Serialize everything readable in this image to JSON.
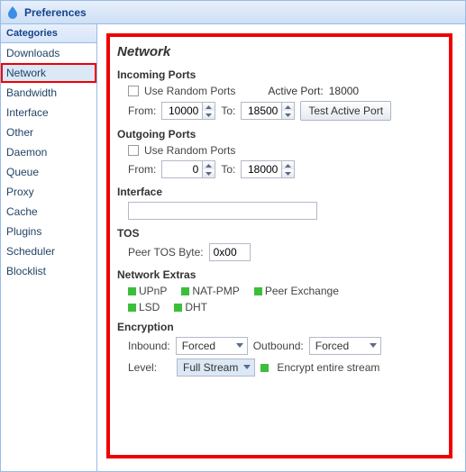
{
  "window": {
    "title": "Preferences"
  },
  "sidebar": {
    "header": "Categories",
    "items": [
      {
        "label": "Downloads"
      },
      {
        "label": "Network",
        "selected": true
      },
      {
        "label": "Bandwidth"
      },
      {
        "label": "Interface"
      },
      {
        "label": "Other"
      },
      {
        "label": "Daemon"
      },
      {
        "label": "Queue"
      },
      {
        "label": "Proxy"
      },
      {
        "label": "Cache"
      },
      {
        "label": "Plugins"
      },
      {
        "label": "Scheduler"
      },
      {
        "label": "Blocklist"
      }
    ]
  },
  "page": {
    "title": "Network",
    "incoming": {
      "title": "Incoming Ports",
      "random_label": "Use Random Ports",
      "active_port_label": "Active Port:",
      "active_port_value": "18000",
      "from_label": "From:",
      "from_value": "10000",
      "to_label": "To:",
      "to_value": "18500",
      "test_button": "Test Active Port"
    },
    "outgoing": {
      "title": "Outgoing Ports",
      "random_label": "Use Random Ports",
      "from_label": "From:",
      "from_value": "0",
      "to_label": "To:",
      "to_value": "18000"
    },
    "interface": {
      "title": "Interface",
      "value": ""
    },
    "tos": {
      "title": "TOS",
      "label": "Peer TOS Byte:",
      "value": "0x00"
    },
    "extras": {
      "title": "Network Extras",
      "items": [
        "UPnP",
        "NAT-PMP",
        "Peer Exchange",
        "LSD",
        "DHT"
      ]
    },
    "encryption": {
      "title": "Encryption",
      "inbound_label": "Inbound:",
      "inbound_value": "Forced",
      "outbound_label": "Outbound:",
      "outbound_value": "Forced",
      "level_label": "Level:",
      "level_value": "Full Stream",
      "entire_label": "Encrypt entire stream"
    }
  }
}
